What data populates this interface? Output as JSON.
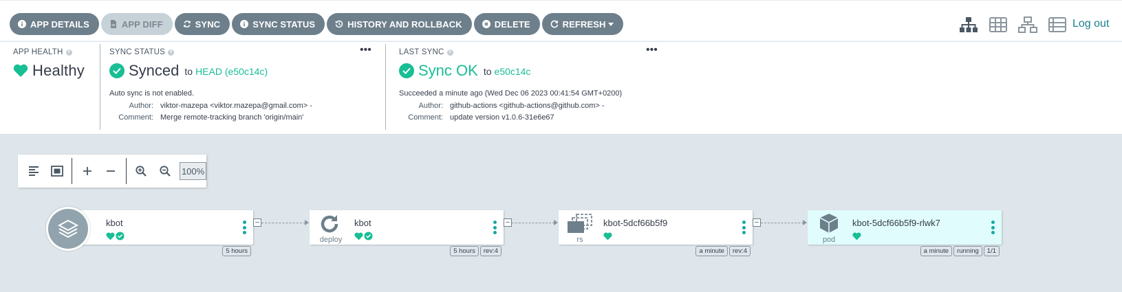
{
  "toolbar": {
    "buttons": [
      {
        "label": "APP DETAILS",
        "icon": "info-circle-icon",
        "disabled": false
      },
      {
        "label": "APP DIFF",
        "icon": "file-icon",
        "disabled": true
      },
      {
        "label": "SYNC",
        "icon": "sync-icon",
        "disabled": false
      },
      {
        "label": "SYNC STATUS",
        "icon": "info-circle-icon",
        "disabled": false
      },
      {
        "label": "HISTORY AND ROLLBACK",
        "icon": "history-icon",
        "disabled": false
      },
      {
        "label": "DELETE",
        "icon": "times-circle-icon",
        "disabled": false
      },
      {
        "label": "REFRESH",
        "icon": "redo-icon",
        "disabled": false
      }
    ],
    "views": [
      "tree-view-icon",
      "pods-view-icon",
      "network-view-icon",
      "list-view-icon"
    ],
    "logout": "Log out"
  },
  "status": {
    "health": {
      "label": "APP HEALTH",
      "value": "Healthy"
    },
    "sync": {
      "label": "SYNC STATUS",
      "value": "Synced",
      "to": "to",
      "revision": "HEAD (e50c14c)",
      "note": "Auto sync is not enabled.",
      "author_label": "Author:",
      "author": "viktor-mazepa <viktor.mazepa@gmail.com> -",
      "comment_label": "Comment:",
      "comment": "Merge remote-tracking branch 'origin/main'"
    },
    "last_sync": {
      "label": "LAST SYNC",
      "value": "Sync OK",
      "to": "to",
      "revision": "e50c14c",
      "note": "Succeeded a minute ago (Wed Dec 06 2023 00:41:54 GMT+0200)",
      "author_label": "Author:",
      "author": "github-actions <github-actions@github.com> -",
      "comment_label": "Comment:",
      "comment": "update version v1.0.6-31e6e67"
    },
    "colors": {
      "healthy": "#18be94",
      "synced": "#18be94"
    }
  },
  "graph_controls": {
    "zoom": "100%"
  },
  "nodes": [
    {
      "name": "kbot",
      "kind": "",
      "tags": [
        "5 hours"
      ]
    },
    {
      "name": "kbot",
      "kind": "deploy",
      "tags": [
        "5 hours",
        "rev:4"
      ]
    },
    {
      "name": "kbot-5dcf66b5f9",
      "kind": "rs",
      "tags": [
        "a minute",
        "rev:4"
      ]
    },
    {
      "name": "kbot-5dcf66b5f9-rlwk7",
      "kind": "pod",
      "tags": [
        "a minute",
        "running",
        "1/1"
      ]
    }
  ]
}
